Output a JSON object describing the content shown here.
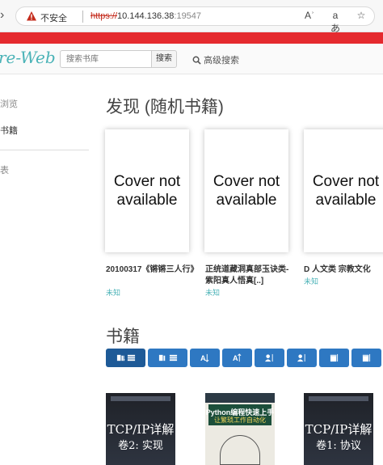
{
  "browser": {
    "security_label": "不安全",
    "url_protocol": "https://",
    "url_host": "10.144.136.38",
    "url_port": ":19547",
    "read_aloud_glyph": "Aʾ",
    "translate_glyph": "aあ",
    "favorite_glyph": "☆"
  },
  "header": {
    "logo_text": "re-Web",
    "search_placeholder": "搜索书库",
    "search_button": "搜索",
    "advanced_search": "高级搜索"
  },
  "sidebar": {
    "items": [
      {
        "label": "浏览",
        "active": false
      },
      {
        "label": "书籍",
        "active": true
      },
      {
        "label": "表",
        "active": false
      }
    ]
  },
  "discover": {
    "title": "发现 (随机书籍)",
    "books": [
      {
        "cover_text": "Cover not available",
        "title": "20100317《锵锵三人行》",
        "author": "未知"
      },
      {
        "cover_text": "Cover not available",
        "title": "正统道藏洞真部玉诀类-紫阳真人悟真[..]",
        "author": "未知"
      },
      {
        "cover_text": "Cover not available",
        "title": "D 人文类 宗教文化",
        "author": "未知"
      }
    ]
  },
  "books_section": {
    "title": "书籍",
    "sort_buttons": [
      {
        "label": "",
        "icon": "book-sort-new-icon",
        "active": true
      },
      {
        "label": "",
        "icon": "book-sort-old-icon",
        "active": false
      },
      {
        "label": "",
        "icon": "title-sort-asc-icon",
        "active": false
      },
      {
        "label": "",
        "icon": "title-sort-desc-icon",
        "active": false
      },
      {
        "label": "",
        "icon": "author-sort-asc-icon",
        "active": false
      },
      {
        "label": "",
        "icon": "author-sort-desc-icon",
        "active": false
      },
      {
        "label": "",
        "icon": "date-sort-asc-icon",
        "active": false
      },
      {
        "label": "",
        "icon": "date-sort-desc-icon",
        "active": false
      }
    ],
    "books": [
      {
        "cover_title": "TCP/IP详解",
        "cover_subtitle": "卷2: 实现"
      },
      {
        "cover_title": "Python编程快速上手",
        "cover_subtitle": "让繁琐工作自动化"
      },
      {
        "cover_title": "TCP/IP详解",
        "cover_subtitle": "卷1: 协议"
      }
    ]
  },
  "colors": {
    "accent": "#2e78c2",
    "accent_active": "#1e5a97",
    "brand": "#4bb3b7",
    "banner": "#e52a2f"
  }
}
